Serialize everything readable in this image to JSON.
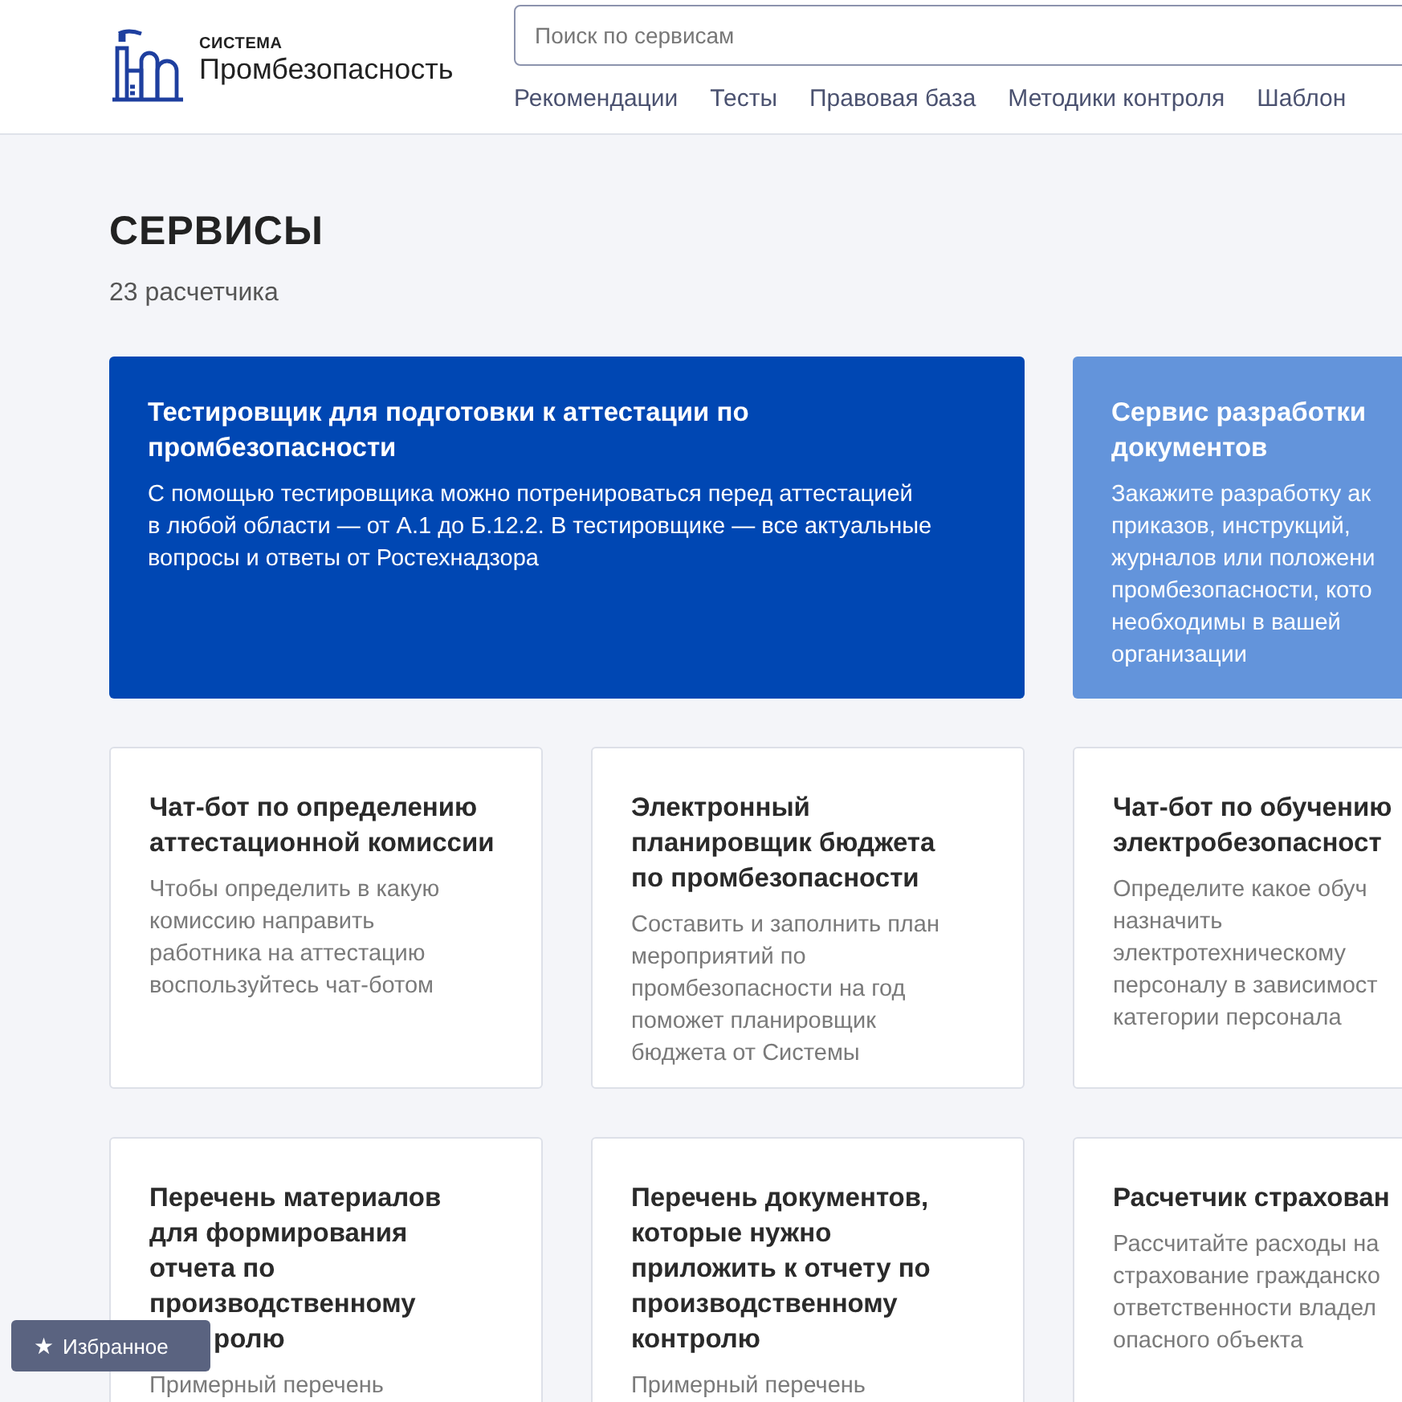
{
  "header": {
    "logo_small": "СИСТЕМА",
    "logo_large": "Промбезопасность",
    "search": {
      "placeholder": "Поиск по сервисам"
    },
    "nav": [
      "Рекомендации",
      "Тесты",
      "Правовая база",
      "Методики контроля",
      "Шаблон"
    ]
  },
  "page": {
    "title": "СЕРВИСЫ",
    "count": "23 расчетчика"
  },
  "cards": [
    {
      "kind": "featured",
      "title": [
        "Тестировщик для подготовки к аттестации по",
        "промбезопасности"
      ],
      "text": [
        "С помощью тестировщика можно потренироваться перед аттестацией",
        "в любой области — от А.1 до Б.12.2. В тестировщике — все актуальные",
        "вопросы и ответы от Ростехнадзора"
      ]
    },
    {
      "kind": "accent",
      "title": [
        "Сервис разработки",
        "документов"
      ],
      "text": [
        "Закажите разработку ак",
        "приказов, инструкций,",
        "журналов или положени",
        "промбезопасности, кото",
        "необходимы в вашей",
        "организации"
      ]
    },
    {
      "kind": "plain",
      "title": [
        "Чат-бот по определению",
        "аттестационной комиссии"
      ],
      "text": [
        "Чтобы определить в какую",
        "комиссию направить",
        "работника на аттестацию",
        "воспользуйтесь чат-ботом"
      ]
    },
    {
      "kind": "plain",
      "title": [
        "Электронный",
        "планировщик бюджета",
        "по промбезопасности"
      ],
      "text": [
        "Составить и заполнить план",
        "мероприятий по",
        "промбезопасности на год",
        "поможет планировщик",
        "бюджета от Системы"
      ]
    },
    {
      "kind": "plain",
      "title": [
        "Чат-бот по обучению",
        "электробезопасност"
      ],
      "text": [
        "Определите какое обуч",
        "назначить",
        "электротехническому",
        "персоналу в зависимост",
        "категории персонала"
      ]
    },
    {
      "kind": "covered",
      "title": [
        "Перечень материалов",
        "для формирования",
        "отчета по",
        "производственному",
        "ролю"
      ],
      "text": [
        "Примерный перечень"
      ]
    },
    {
      "kind": "plain",
      "title": [
        "Перечень документов,",
        "которые нужно",
        "приложить к отчету по",
        "производственному",
        "контролю"
      ],
      "text": [
        "Примерный перечень"
      ]
    },
    {
      "kind": "plain",
      "title": [
        "Расчетчик страхован"
      ],
      "text": [
        "Рассчитайте расходы на",
        "страхование гражданско",
        "ответственности владел",
        "опасного объекта"
      ]
    }
  ],
  "favorites_button": {
    "icon": "★",
    "label": "Избранное"
  }
}
